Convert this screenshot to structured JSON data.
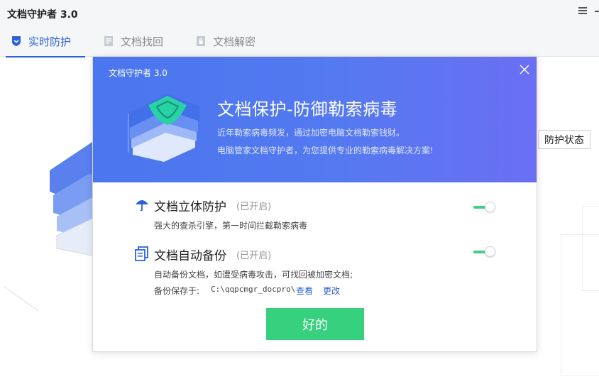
{
  "window": {
    "title": "文档守护者 3.0"
  },
  "tabs": [
    {
      "label": "实时防护",
      "icon": "shield-icon",
      "active": true
    },
    {
      "label": "文档找回",
      "icon": "document-icon",
      "active": false
    },
    {
      "label": "文档解密",
      "icon": "lock-document-icon",
      "active": false
    }
  ],
  "page": {
    "status_label": "防护状态"
  },
  "dialog": {
    "title": "文档守护者 3.0",
    "hero_title": "文档保护-防御勒索病毒",
    "hero_lines": [
      "近年勒索病毒频发，通过加密电脑文档勒索钱财。",
      "电脑管家文档守护者，为您提供专业的勒索病毒解决方案!"
    ],
    "features": [
      {
        "title": "文档立体防护",
        "state": "(已开启)",
        "desc": "强大的查杀引擎，第一时间拦截勒索病毒",
        "enabled": true
      },
      {
        "title": "文档自动备份",
        "state": "(已开启)",
        "desc": "自动备份文档，如遭受病毒攻击，可找回被加密文档;",
        "enabled": true
      }
    ],
    "backup": {
      "prefix": "备份保存于:",
      "path": "C:\\qqpcmgr_docpro\\",
      "view_label": "查看",
      "change_label": "更改"
    },
    "ok_label": "好的"
  },
  "colors": {
    "accent": "#2a63d8",
    "header_blue": "#5479f0",
    "toggle_on": "#3dd08a",
    "ok_green": "#36d07f"
  }
}
